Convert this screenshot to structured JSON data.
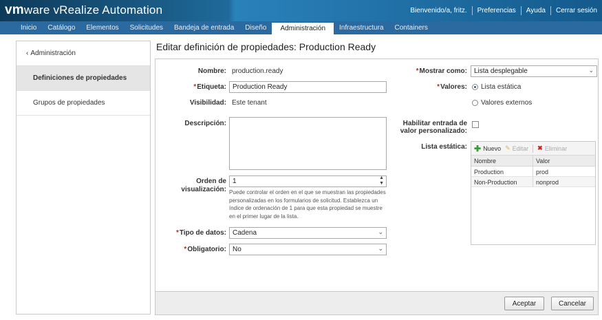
{
  "header": {
    "brand_vm": "vm",
    "brand_ware": "ware",
    "brand_product": " vRealize",
    "brand_product2": " Automation",
    "welcome": "Bienvenido/a, fritz.",
    "preferences": "Preferencias",
    "help": "Ayuda",
    "logout": "Cerrar sesión"
  },
  "nav": {
    "tabs": [
      {
        "label": "Inicio"
      },
      {
        "label": "Catálogo"
      },
      {
        "label": "Elementos"
      },
      {
        "label": "Solicitudes"
      },
      {
        "label": "Bandeja de entrada"
      },
      {
        "label": "Diseño"
      },
      {
        "label": "Administración"
      },
      {
        "label": "Infraestructura"
      },
      {
        "label": "Containers"
      }
    ],
    "active": "Administración"
  },
  "sidebar": {
    "back_label": "Administración",
    "items": [
      {
        "label": "Definiciones de propiedades"
      },
      {
        "label": "Grupos de propiedades"
      }
    ]
  },
  "page": {
    "title": "Editar definición de propiedades: Production Ready"
  },
  "form": {
    "name_label": "Nombre:",
    "name_value": "production.ready",
    "tag_label": "Etiqueta:",
    "tag_value": "Production Ready",
    "visibility_label": "Visibilidad:",
    "visibility_value": "Este tenant",
    "description_label": "Descripción:",
    "description_value": "",
    "order_label_1": "Orden de",
    "order_label_2": "visualización:",
    "order_value": "1",
    "order_help": "Puede controlar el orden en el que se muestran las propiedades personalizadas en los formularios de solicitud. Establezca un índice de ordenación de 1 para que esta propiedad se muestre en el primer lugar de la lista.",
    "datatype_label": "Tipo de datos:",
    "datatype_value": "Cadena",
    "required_label": "Obligatorio:",
    "required_value": "No",
    "display_as_label": "Mostrar como:",
    "display_as_value": "Lista desplegable",
    "values_label": "Valores:",
    "values_option_static": "Lista estática",
    "values_option_external": "Valores externos",
    "values_selected": "Lista estática",
    "custom_entry_label_1": "Habilitar entrada de",
    "custom_entry_label_2": "valor personalizado:",
    "custom_entry_checked": false,
    "static_list_label": "Lista estática:"
  },
  "static_list": {
    "toolbar": {
      "new_label": "Nuevo",
      "edit_label": "Editar",
      "delete_label": "Eliminar"
    },
    "columns": [
      "Nombre",
      "Valor"
    ],
    "rows": [
      {
        "name": "Production",
        "value": "prod"
      },
      {
        "name": "Non-Production",
        "value": "nonprod"
      }
    ]
  },
  "footer": {
    "accept_label": "Aceptar",
    "cancel_label": "Cancelar"
  },
  "colors": {
    "header_bg": "#145a8c",
    "nav_bg": "#2b6aa0",
    "required_marker": "#d0201b",
    "add_icon": "#3a9a3a",
    "delete_icon": "#d0201b"
  },
  "icons": {
    "back": "chevron-left-icon",
    "select": "chevron-down-icon",
    "stepper": "up-down-arrows-icon",
    "new": "plus-icon",
    "edit": "pencil-icon",
    "delete": "x-icon"
  }
}
